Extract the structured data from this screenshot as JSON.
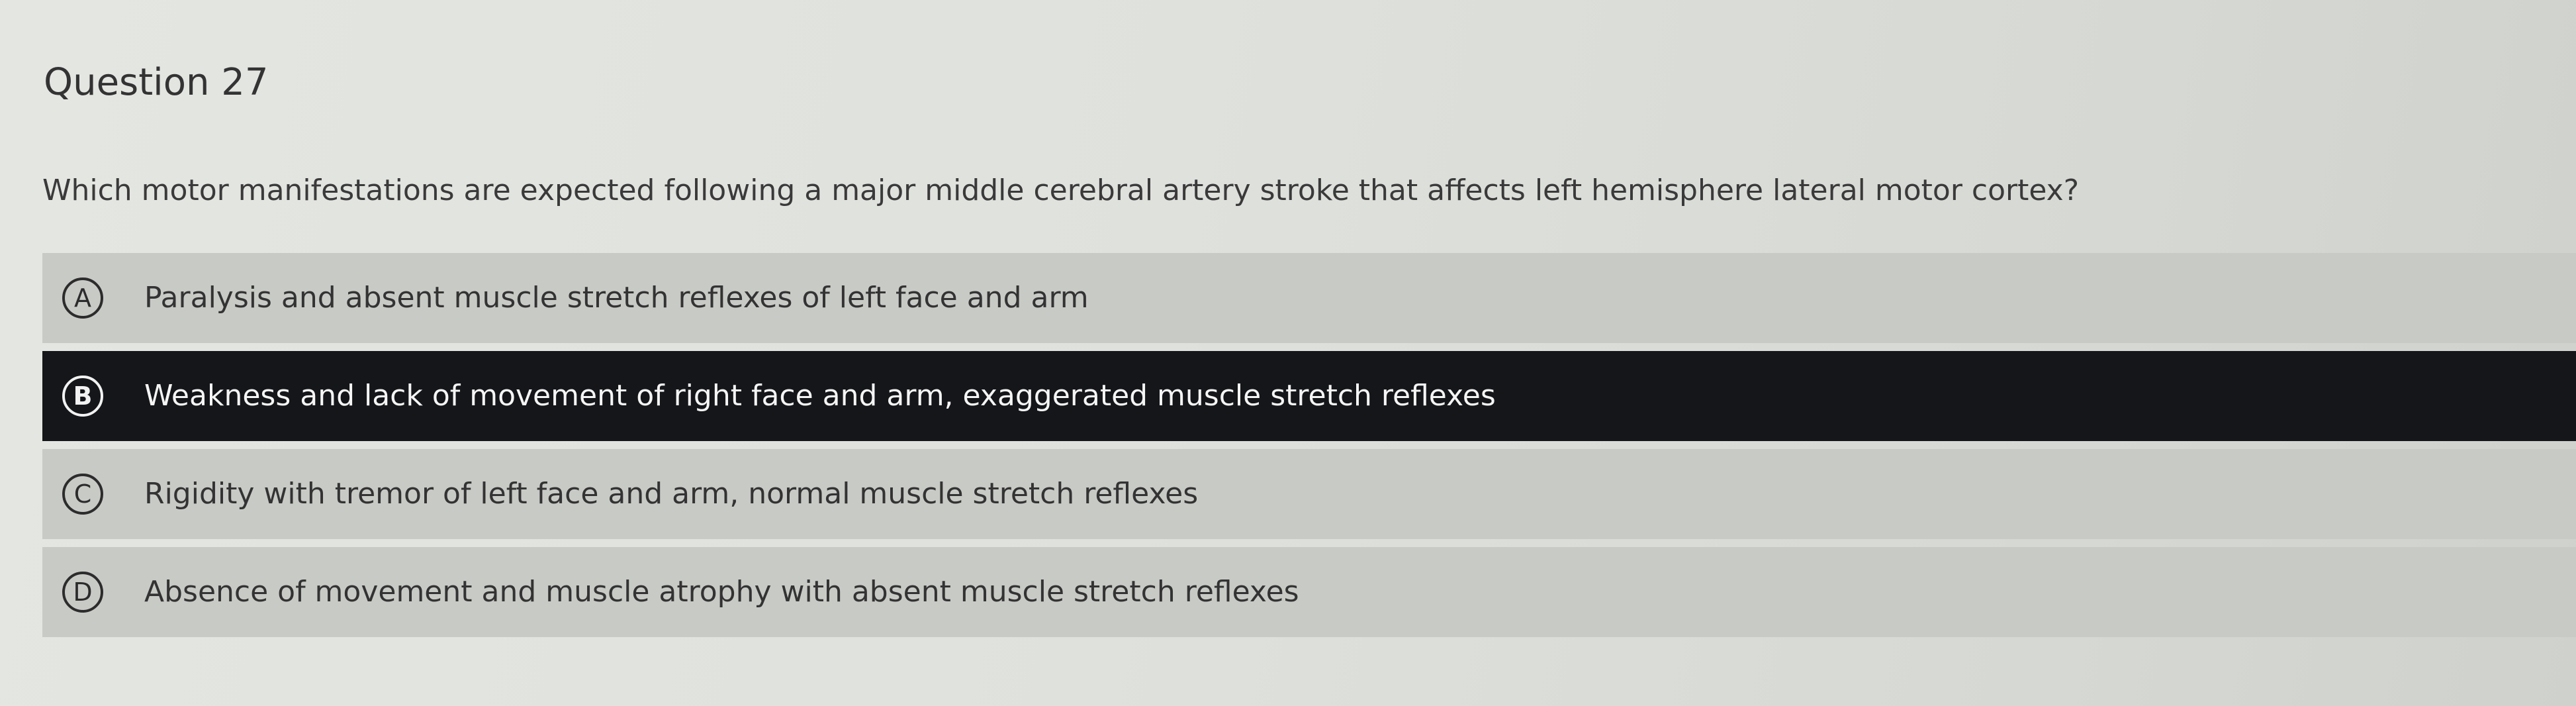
{
  "question": {
    "title": "Question 27",
    "text": "Which motor manifestations are expected following a major middle cerebral artery stroke that affects left hemisphere lateral motor cortex?"
  },
  "choices": [
    {
      "letter": "A",
      "text": "Paralysis and absent muscle stretch reflexes of left face and arm",
      "selected": false
    },
    {
      "letter": "B",
      "text": "Weakness and lack of movement of right face and arm, exaggerated muscle stretch reflexes",
      "selected": true
    },
    {
      "letter": "C",
      "text": "Rigidity with tremor of left face and arm, normal muscle stretch reflexes",
      "selected": false
    },
    {
      "letter": "D",
      "text": "Absence of movement and muscle atrophy with absent muscle stretch reflexes",
      "selected": false
    }
  ],
  "colors": {
    "selected_background": "#141619",
    "option_background": "#c8cac6",
    "page_background": "#e0e2de"
  }
}
